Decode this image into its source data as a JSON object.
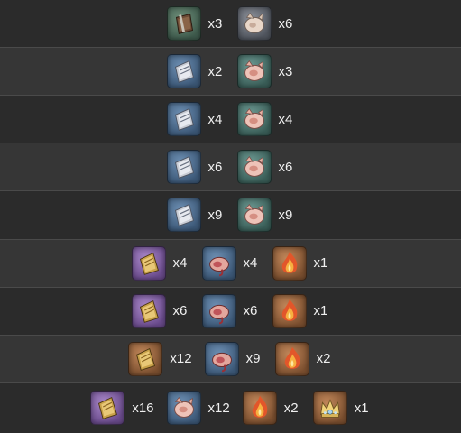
{
  "rows": [
    {
      "items": [
        {
          "icon": "brown-tome-icon",
          "bg": "green",
          "qty": "x3"
        },
        {
          "icon": "pale-ore-icon",
          "bg": "grey",
          "qty": "x6"
        }
      ]
    },
    {
      "items": [
        {
          "icon": "silver-tome-icon",
          "bg": "blue",
          "qty": "x2"
        },
        {
          "icon": "pink-ore-icon",
          "bg": "teal",
          "qty": "x3"
        }
      ]
    },
    {
      "items": [
        {
          "icon": "silver-tome-icon",
          "bg": "blue",
          "qty": "x4"
        },
        {
          "icon": "pink-ore-icon",
          "bg": "teal",
          "qty": "x4"
        }
      ]
    },
    {
      "items": [
        {
          "icon": "silver-tome-icon",
          "bg": "blue",
          "qty": "x6"
        },
        {
          "icon": "pink-ore-icon",
          "bg": "teal",
          "qty": "x6"
        }
      ]
    },
    {
      "items": [
        {
          "icon": "silver-tome-icon",
          "bg": "blue",
          "qty": "x9"
        },
        {
          "icon": "pink-ore-icon",
          "bg": "teal",
          "qty": "x9"
        }
      ]
    },
    {
      "items": [
        {
          "icon": "gold-tome-icon",
          "bg": "purple",
          "qty": "x4"
        },
        {
          "icon": "crimson-ore-icon",
          "bg": "blue",
          "qty": "x4"
        },
        {
          "icon": "flame-core-icon",
          "bg": "orange",
          "qty": "x1"
        }
      ]
    },
    {
      "items": [
        {
          "icon": "gold-tome-icon",
          "bg": "purple",
          "qty": "x6"
        },
        {
          "icon": "crimson-ore-icon",
          "bg": "blue",
          "qty": "x6"
        },
        {
          "icon": "flame-core-icon",
          "bg": "orange",
          "qty": "x1"
        }
      ]
    },
    {
      "items": [
        {
          "icon": "gold-tome-icon",
          "bg": "orange",
          "qty": "x12"
        },
        {
          "icon": "crimson-ore-icon",
          "bg": "blue",
          "qty": "x9"
        },
        {
          "icon": "flame-core-icon",
          "bg": "orange",
          "qty": "x2"
        }
      ]
    },
    {
      "items": [
        {
          "icon": "gold-tome-icon",
          "bg": "purple",
          "qty": "x16"
        },
        {
          "icon": "pink-ore-icon",
          "bg": "blue",
          "qty": "x12"
        },
        {
          "icon": "flame-core-icon",
          "bg": "orange",
          "qty": "x2"
        },
        {
          "icon": "crown-icon",
          "bg": "orange",
          "qty": "x1"
        }
      ]
    }
  ]
}
